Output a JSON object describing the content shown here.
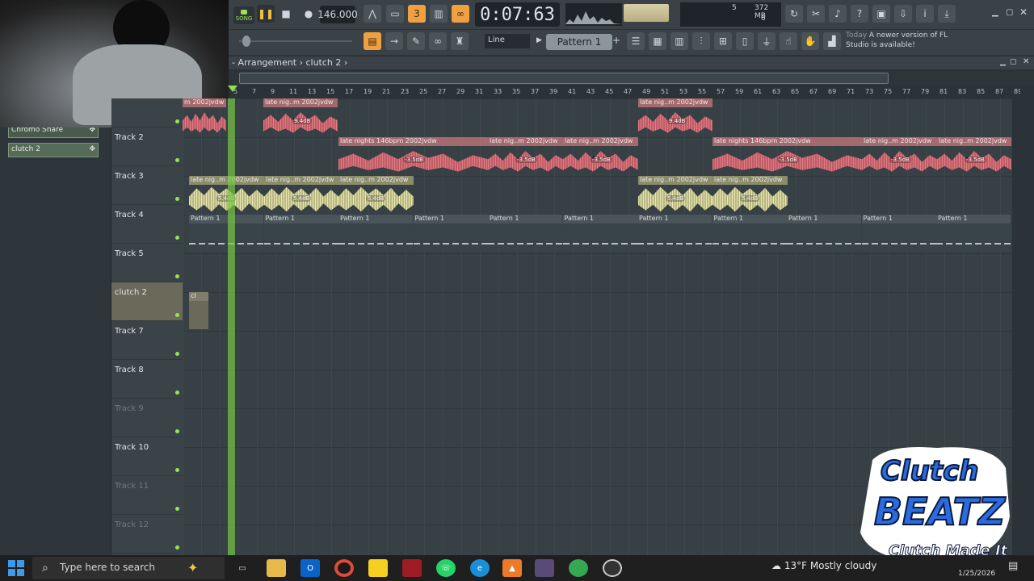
{
  "transport": {
    "song_label": "SONG",
    "tempo": "146.000",
    "time": "0:07:63"
  },
  "cpu": {
    "voices": "5",
    "memory": "372 MB",
    "poly": "6"
  },
  "toolbar": {
    "snap": "Line",
    "pattern": "Pattern 1",
    "pattern_add": "+",
    "news_day": "Today",
    "news_text": "A newer version of FL Studio is available!"
  },
  "arrangement": {
    "breadcrumb": "- Arrangement › clutch 2 ›"
  },
  "ruler": [
    "5",
    "7",
    "9",
    "11",
    "13",
    "15",
    "17",
    "19",
    "21",
    "23",
    "25",
    "27",
    "29",
    "31",
    "33",
    "35",
    "37",
    "39",
    "41",
    "43",
    "45",
    "47",
    "49",
    "51",
    "53",
    "55",
    "57",
    "59",
    "61",
    "63",
    "65",
    "67",
    "69",
    "71",
    "73",
    "75",
    "77",
    "79",
    "81",
    "83",
    "85",
    "87",
    "89"
  ],
  "browser": {
    "items": [
      "Chromo Snare",
      "clutch 2"
    ]
  },
  "tracks": [
    {
      "label": "",
      "dim": false,
      "sel": false
    },
    {
      "label": "Track 2",
      "dim": false,
      "sel": false
    },
    {
      "label": "Track 3",
      "dim": false,
      "sel": false
    },
    {
      "label": "Track 4",
      "dim": false,
      "sel": false
    },
    {
      "label": "Track 5",
      "dim": false,
      "sel": false
    },
    {
      "label": "clutch 2",
      "dim": false,
      "sel": true
    },
    {
      "label": "Track 7",
      "dim": false,
      "sel": false
    },
    {
      "label": "Track 8",
      "dim": false,
      "sel": false
    },
    {
      "label": "Track 9",
      "dim": true,
      "sel": false
    },
    {
      "label": "Track 10",
      "dim": false,
      "sel": false
    },
    {
      "label": "Track 11",
      "dim": true,
      "sel": false
    },
    {
      "label": "Track 12",
      "dim": true,
      "sel": false
    }
  ],
  "clips": {
    "r1a": "m 2002jvdw",
    "r1b": "late nig..m 2002jvdw",
    "r1c": "late nig..m 2002jvdw",
    "r1_db": "9.4dB",
    "r1_db_short": "dB",
    "r2a": "late nights 146bpm 2002jvdw",
    "r2b": "late nig..m 2002jvdw",
    "r2c": "late nig..m 2002jvdw",
    "r2d": "late nights 146bpm 2002jvdw",
    "r2e": "late nig..m 2002jvdw",
    "r2f": "late nig..m 2002jvdw",
    "r2_db": "-3.5dB",
    "r3a": "late nig..m 2002jvdw",
    "r3b": "late nig..m 2002jvdw",
    "r3c": "late nig..m 2002jvdw",
    "r3d": "late nig..m 2002jvdw",
    "r3e": "late nig..m 2002jvdw",
    "r3_db": "5.4dB",
    "pattern": "Pattern 1",
    "clutch": "cl"
  },
  "taskbar": {
    "search_placeholder": "Type here to search",
    "weather": "13°F  Mostly cloudy",
    "date": "1/25/2026"
  },
  "logo": {
    "line1": "Clutch",
    "line2": "BEATZ",
    "line3": "Clutch Made It"
  },
  "colors": {
    "audio_red": "#e07c84",
    "audio_yellow": "#e8e6b0",
    "playhead": "#78c846",
    "accent": "#f0a040"
  }
}
